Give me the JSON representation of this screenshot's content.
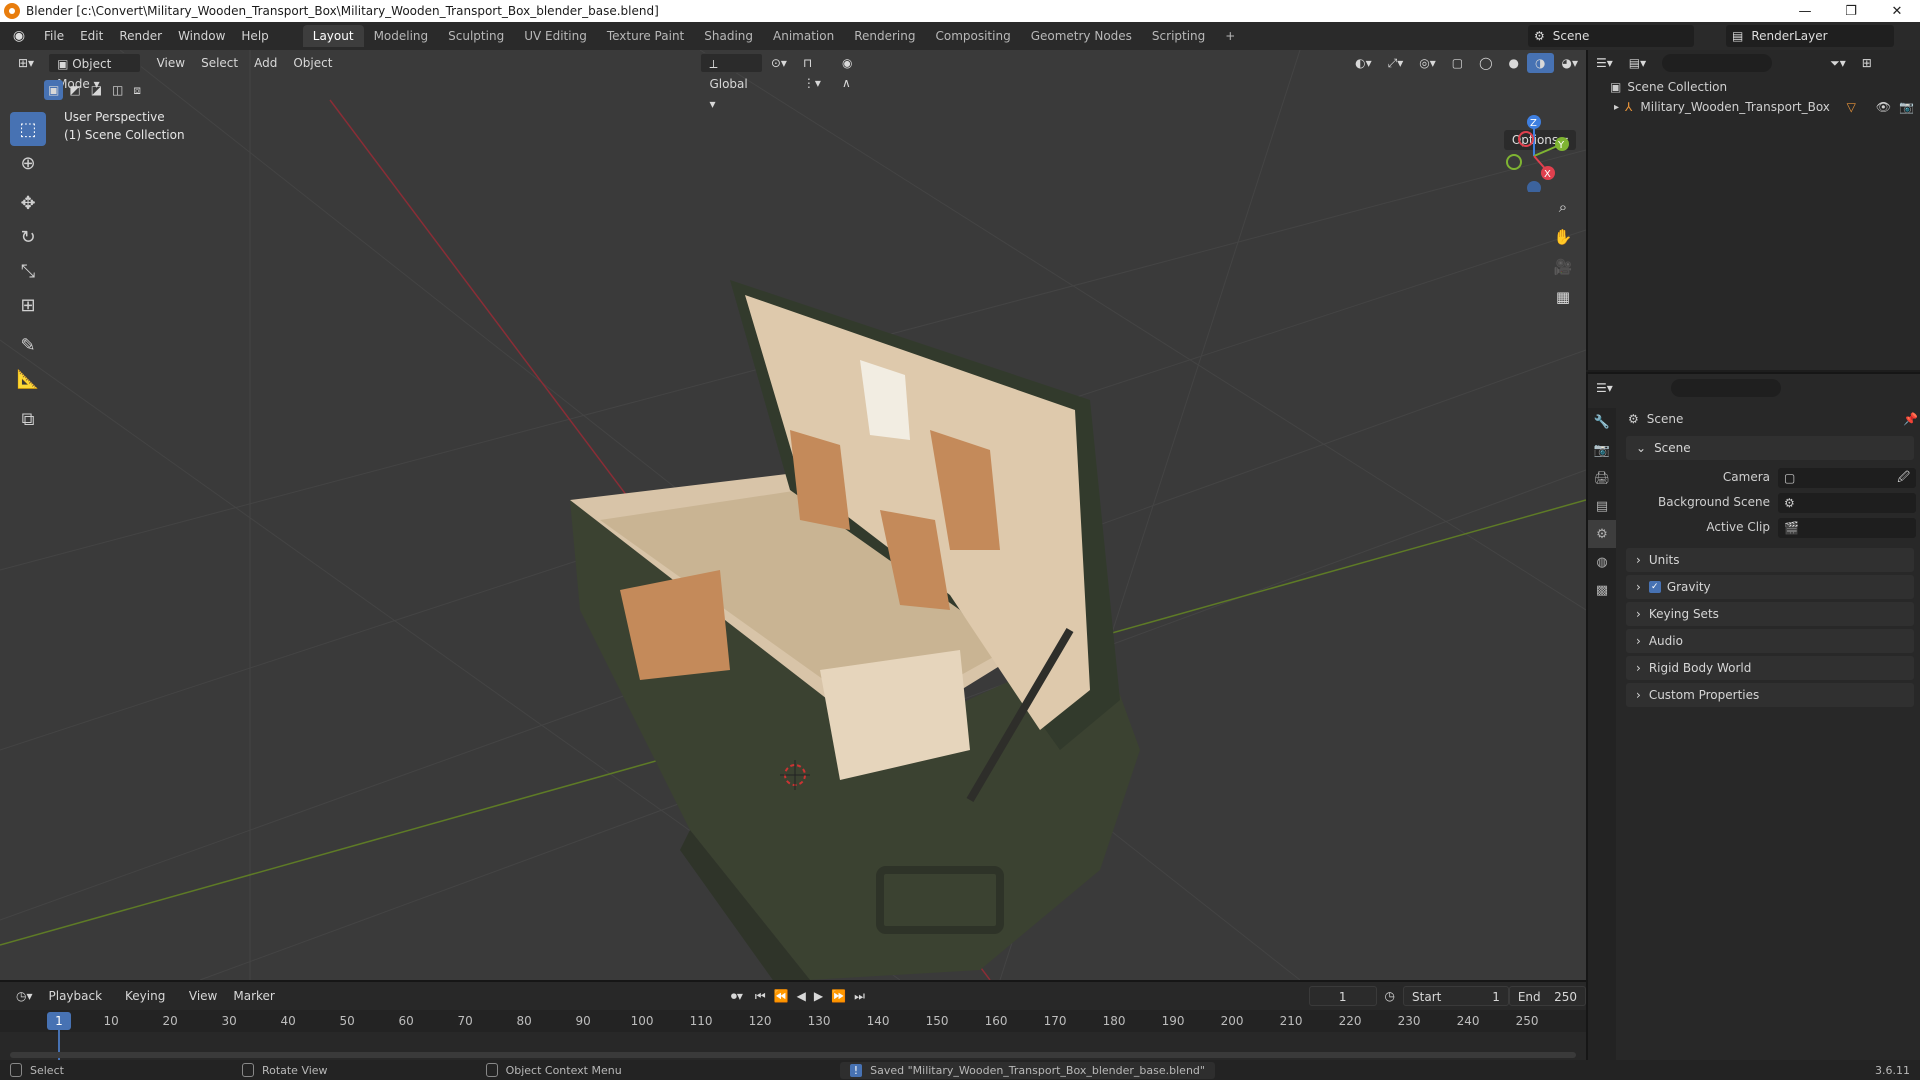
{
  "window": {
    "title": "Blender [c:\\Convert\\Military_Wooden_Transport_Box\\Military_Wooden_Transport_Box_blender_base.blend]",
    "min": "—",
    "max": "❐",
    "close": "✕"
  },
  "topbar": {
    "menus": [
      "File",
      "Edit",
      "Render",
      "Window",
      "Help"
    ],
    "workspaces": [
      "Layout",
      "Modeling",
      "Sculpting",
      "UV Editing",
      "Texture Paint",
      "Shading",
      "Animation",
      "Rendering",
      "Compositing",
      "Geometry Nodes",
      "Scripting"
    ],
    "active_workspace": "Layout",
    "add_tab": "+",
    "scene": "Scene",
    "view_layer": "RenderLayer"
  },
  "viewport": {
    "mode": "Object Mode",
    "menus": [
      "View",
      "Select",
      "Add",
      "Object"
    ],
    "transform_orientation": "Global",
    "options": "Options",
    "perspective_label": "User Perspective",
    "collection_label": "(1) Scene Collection",
    "gizmo": {
      "x": "X",
      "y": "Y",
      "z": "Z"
    },
    "axis_colors": {
      "x": "#e0404e",
      "y": "#7fb432",
      "z": "#3e7fe0"
    }
  },
  "outliner": {
    "root": "Scene Collection",
    "items": [
      {
        "label": "Military_Wooden_Transport_Box"
      }
    ]
  },
  "properties": {
    "context": "Scene",
    "section": "Scene",
    "fields": [
      {
        "label": "Camera",
        "value": ""
      },
      {
        "label": "Background Scene",
        "value": ""
      },
      {
        "label": "Active Clip",
        "value": ""
      }
    ],
    "panels": [
      "Units",
      "Gravity",
      "Keying Sets",
      "Audio",
      "Rigid Body World",
      "Custom Properties"
    ],
    "gravity_checked": true
  },
  "timeline": {
    "menus": [
      "Playback",
      "Keying",
      "View",
      "Marker"
    ],
    "current_frame": "1",
    "start_label": "Start",
    "start": "1",
    "end_label": "End",
    "end": "250",
    "ticks": [
      "1",
      "10",
      "20",
      "30",
      "40",
      "50",
      "60",
      "70",
      "80",
      "90",
      "100",
      "110",
      "120",
      "130",
      "140",
      "150",
      "160",
      "170",
      "180",
      "190",
      "200",
      "210",
      "220",
      "230",
      "240",
      "250"
    ]
  },
  "status": {
    "select": "Select",
    "rotate": "Rotate View",
    "context_menu": "Object Context Menu",
    "message": "Saved \"Military_Wooden_Transport_Box_blender_base.blend\"",
    "version": "3.6.11"
  }
}
